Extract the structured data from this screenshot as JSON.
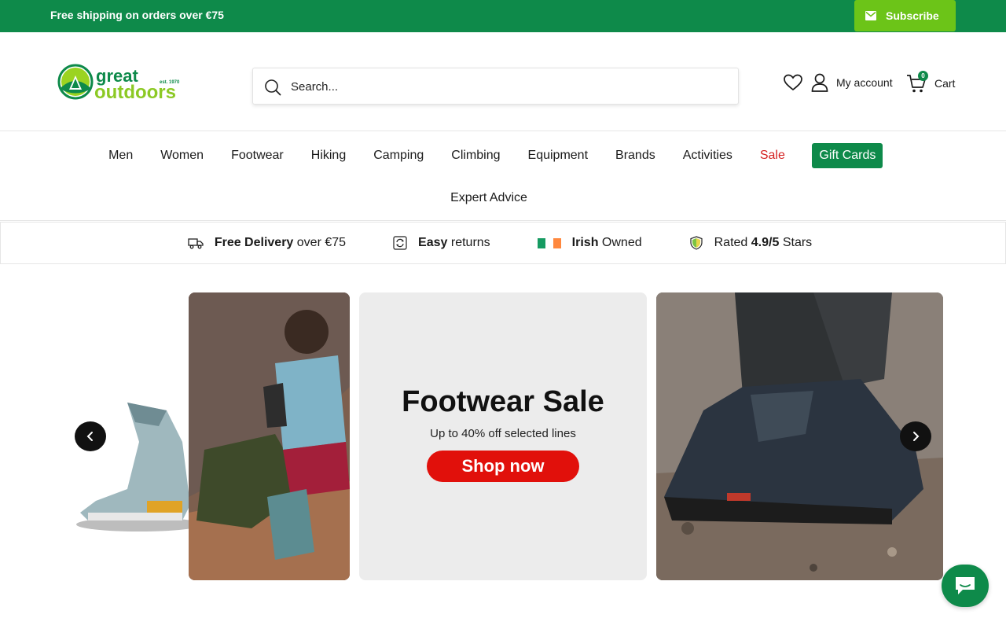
{
  "announcement": {
    "text": "Free shipping on orders over €75",
    "subscribe_label": "Subscribe"
  },
  "header": {
    "logo_text_top": "great",
    "logo_text_bottom": "outdoors",
    "logo_est": "est. 1970",
    "search_placeholder": "Search...",
    "account_label": "My account",
    "cart_label": "Cart",
    "cart_count": "0"
  },
  "nav": {
    "items": [
      "Men",
      "Women",
      "Footwear",
      "Hiking",
      "Camping",
      "Climbing",
      "Equipment",
      "Brands",
      "Activities"
    ],
    "sale_label": "Sale",
    "gift_label": "Gift Cards",
    "expert_label": "Expert Advice"
  },
  "trust": {
    "delivery_bold": "Free Delivery",
    "delivery_rest": "over €75",
    "returns_bold": "Easy",
    "returns_rest": "returns",
    "irish_bold": "Irish",
    "irish_rest": "Owned",
    "rated_pre": "Rated",
    "rated_bold": "4.9/5",
    "rated_rest": "Stars"
  },
  "promo": {
    "title": "Footwear Sale",
    "subtitle": "Up to 40% off selected lines",
    "cta": "Shop now"
  },
  "colors": {
    "brand_green": "#0e8a4a",
    "subscribe_green": "#6cc418",
    "sale_red": "#d41f1f",
    "cta_red": "#e1100b"
  }
}
